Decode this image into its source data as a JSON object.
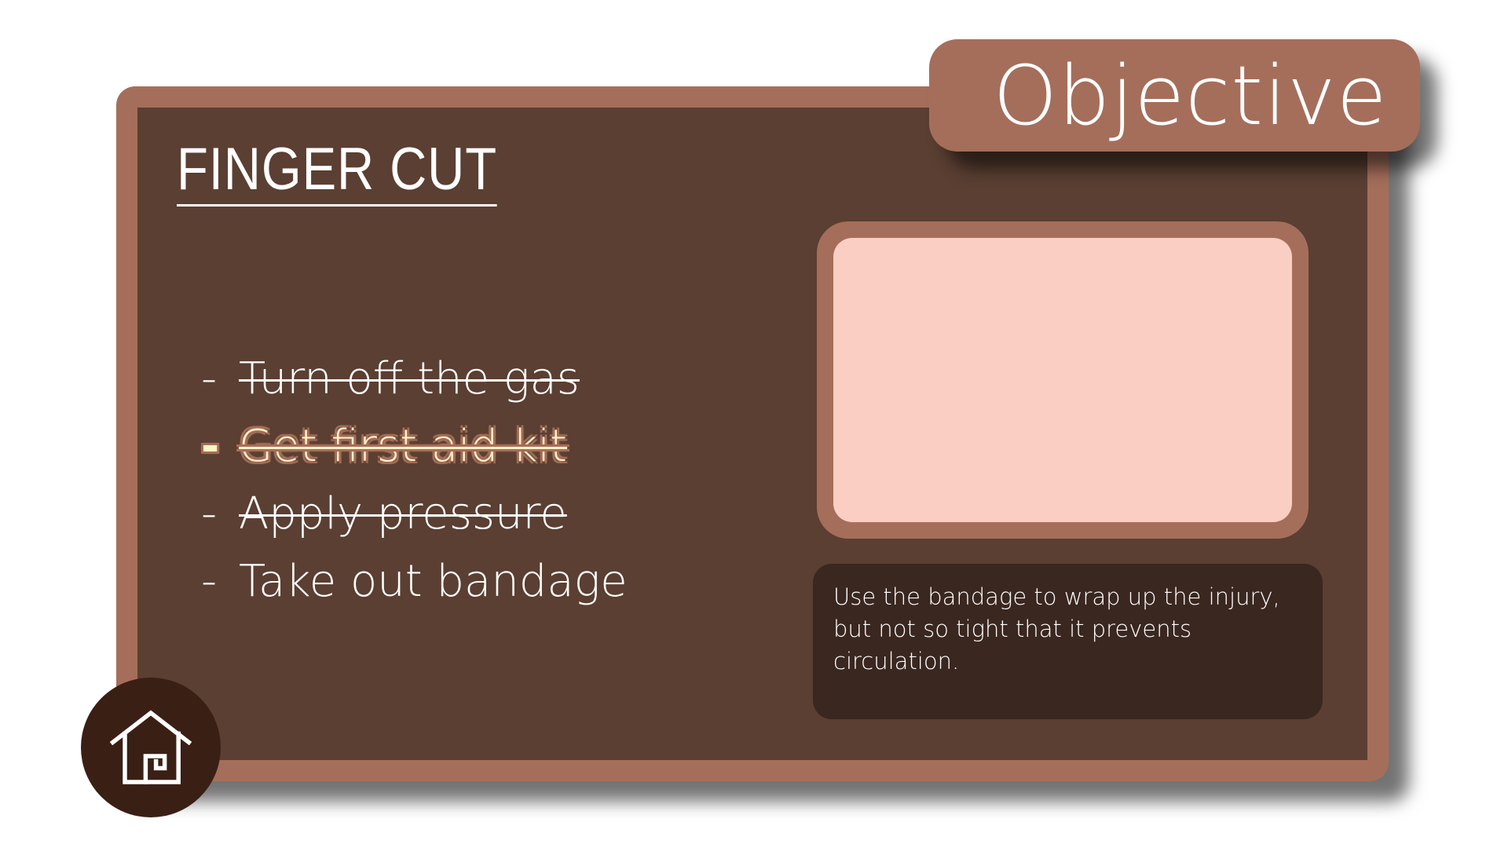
{
  "objective": {
    "label": "Objective"
  },
  "title": "FINGER CUT",
  "tasks": [
    {
      "dash": "-",
      "text": "Turn off the gas",
      "status": "done"
    },
    {
      "dash": "-",
      "text": "Get first aid kit",
      "status": "done-active"
    },
    {
      "dash": "-",
      "text": "Apply pressure",
      "status": "done"
    },
    {
      "dash": "-",
      "text": "Take out bandage",
      "status": "pending"
    }
  ],
  "instruction": {
    "line1": "Use the bandage to wrap up the injury,",
    "line2": "but not so tight that it prevents circulation."
  },
  "home": {
    "icon": "home-icon"
  },
  "colors": {
    "frame": "#a56e5b",
    "board": "#5a3f32",
    "instruction_bg": "#3a2720",
    "image_panel": "#fbcec3",
    "home_bg": "#3a1f15",
    "highlight_text": "#fff2c4"
  }
}
